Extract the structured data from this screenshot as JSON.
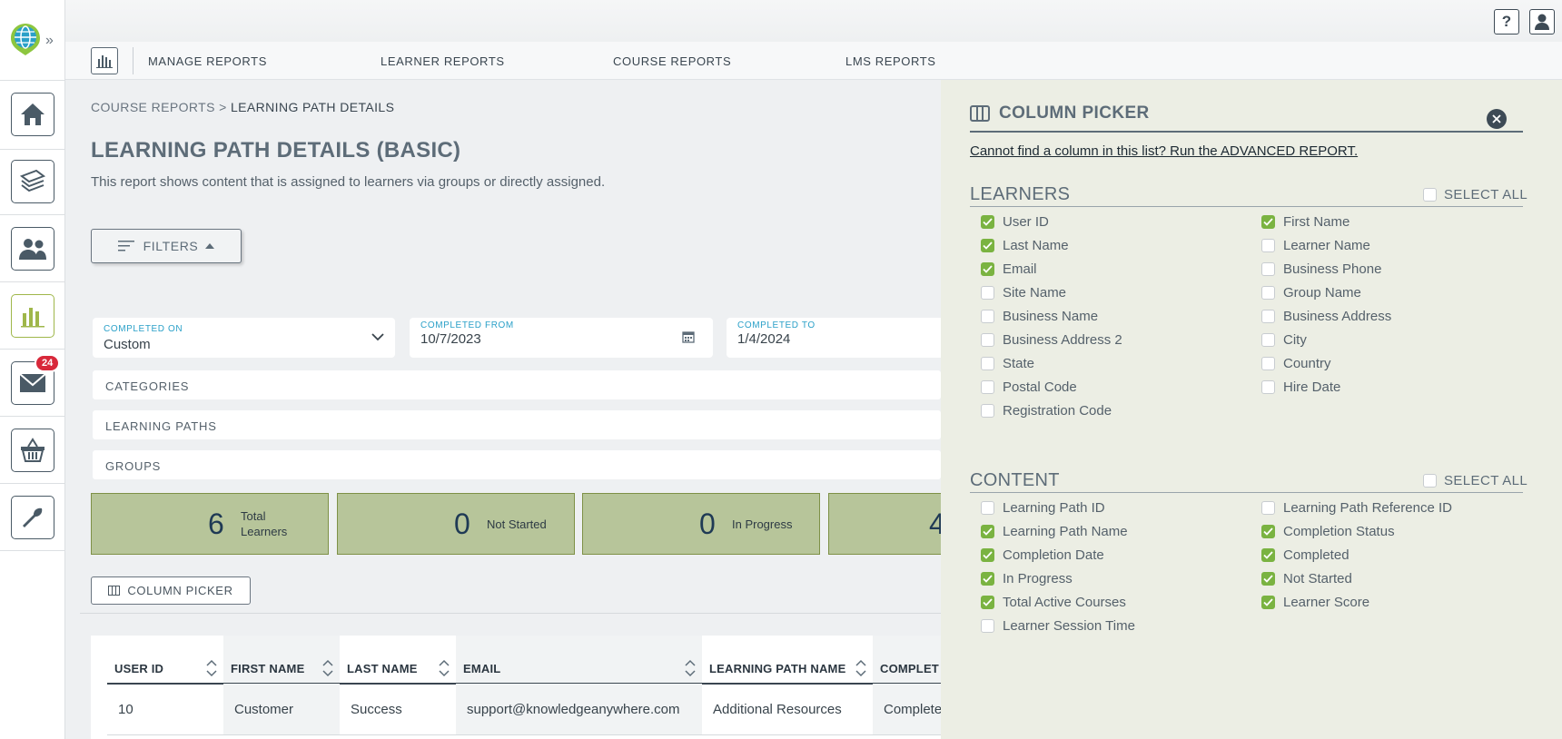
{
  "rail": {
    "badge_count": "24",
    "items": [
      "home-icon",
      "courses-icon",
      "users-icon",
      "reports-icon",
      "mail-icon",
      "store-icon",
      "tools-icon"
    ]
  },
  "topbar": {
    "help_glyph": "?"
  },
  "nav": {
    "items": [
      "MANAGE REPORTS",
      "LEARNER REPORTS",
      "COURSE REPORTS",
      "LMS REPORTS"
    ]
  },
  "breadcrumb": {
    "parent": "COURSE REPORTS",
    "sep": ">",
    "current": "LEARNING PATH DETAILS"
  },
  "page": {
    "title": "LEARNING PATH DETAILS (BASIC)",
    "description": "This report shows content that is assigned to learners via groups or directly assigned."
  },
  "filters": {
    "button_label": "FILTERS",
    "completed_on": {
      "label": "COMPLETED ON",
      "value": "Custom"
    },
    "completed_from": {
      "label": "COMPLETED FROM",
      "value": "10/7/2023"
    },
    "completed_to": {
      "label": "COMPLETED TO",
      "value": "1/4/2024"
    },
    "categories": "CATEGORIES",
    "learning_paths": "LEARNING PATHS",
    "groups": "GROUPS"
  },
  "stats": [
    {
      "value": "6",
      "label_line1": "Total",
      "label_line2": "Learners"
    },
    {
      "value": "0",
      "label_line1": "Not Started",
      "label_line2": ""
    },
    {
      "value": "0",
      "label_line1": "In Progress",
      "label_line2": ""
    },
    {
      "value": "4",
      "label_line1": "",
      "label_line2": ""
    }
  ],
  "column_picker_button": "COLUMN PICKER",
  "table": {
    "headers": [
      "USER ID",
      "FIRST NAME",
      "LAST NAME",
      "EMAIL",
      "LEARNING PATH NAME",
      "COMPLET"
    ],
    "rows": [
      [
        "10",
        "Customer",
        "Success",
        "support@knowledgeanywhere.com",
        "Additional Resources",
        "Complete"
      ]
    ]
  },
  "panel": {
    "title": "COLUMN PICKER",
    "advanced_link": "Cannot find a column in this list? Run the ADVANCED REPORT.",
    "learners": {
      "title": "LEARNERS",
      "select_all": "SELECT ALL",
      "select_all_checked": false,
      "options": [
        {
          "label": "User ID",
          "checked": true
        },
        {
          "label": "First Name",
          "checked": true
        },
        {
          "label": "Last Name",
          "checked": true
        },
        {
          "label": "Learner Name",
          "checked": false
        },
        {
          "label": "Email",
          "checked": true
        },
        {
          "label": "Business Phone",
          "checked": false
        },
        {
          "label": "Site Name",
          "checked": false
        },
        {
          "label": "Group Name",
          "checked": false
        },
        {
          "label": "Business Name",
          "checked": false
        },
        {
          "label": "Business Address",
          "checked": false
        },
        {
          "label": "Business Address 2",
          "checked": false
        },
        {
          "label": "City",
          "checked": false
        },
        {
          "label": "State",
          "checked": false
        },
        {
          "label": "Country",
          "checked": false
        },
        {
          "label": "Postal Code",
          "checked": false
        },
        {
          "label": "Hire Date",
          "checked": false
        },
        {
          "label": "Registration Code",
          "checked": false
        }
      ]
    },
    "content": {
      "title": "CONTENT",
      "select_all": "SELECT ALL",
      "select_all_checked": false,
      "options": [
        {
          "label": "Learning Path ID",
          "checked": false
        },
        {
          "label": "Learning Path Reference ID",
          "checked": false
        },
        {
          "label": "Learning Path Name",
          "checked": true
        },
        {
          "label": "Completion Status",
          "checked": true
        },
        {
          "label": "Completion Date",
          "checked": true
        },
        {
          "label": "Completed",
          "checked": true
        },
        {
          "label": "In Progress",
          "checked": true
        },
        {
          "label": "Not Started",
          "checked": true
        },
        {
          "label": "Total Active Courses",
          "checked": true
        },
        {
          "label": "Learner Score",
          "checked": true
        },
        {
          "label": "Learner Session Time",
          "checked": false
        }
      ]
    }
  },
  "colors": {
    "accent_green": "#7ab341",
    "stat_fill": "#b7c59a",
    "badge_red": "#d8283a",
    "link_blue": "#2aa0c8"
  }
}
